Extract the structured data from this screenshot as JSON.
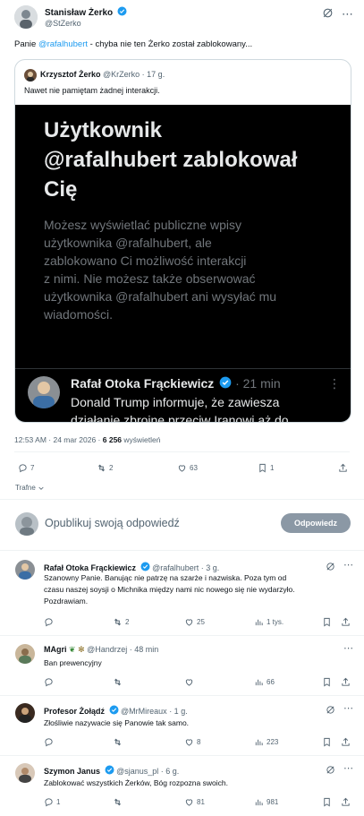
{
  "main_tweet": {
    "author_name": "Stanisław Żerko",
    "author_handle": "@StZerko",
    "text_prefix": "Panie ",
    "mention": "@rafalhubert",
    "text_suffix": " - chyba nie ten Żerko został zablokowany...",
    "timestamp": "12:53 AM · 24 mar 2026 · ",
    "views_count": "6 256",
    "views_label": " wyświetleń"
  },
  "quote": {
    "author_name": "Krzysztof Żerko",
    "author_handle": "@KrZerko · 17 g.",
    "text": "Nawet nie pamiętam żadnej interakcji.",
    "image": {
      "title_line1": "Użytkownik",
      "title_line2": "@rafalhubert zablokował",
      "title_line3": "Cię",
      "body_line1": "Możesz wyświetlać publiczne wpisy",
      "body_line2": "użytkownika @rafalhubert, ale",
      "body_line3": "zablokowano Ci możliwość interakcji",
      "body_line4": "z nimi. Nie możesz także obserwować",
      "body_line5": "użytkownika @rafalhubert ani wysyłać mu",
      "body_line6": "wiadomości.",
      "inner_author": "Rafał Otoka Frąckiewicz",
      "inner_time": "· 21 min",
      "inner_text_line1": "Donald Trump informuje, że zawiesza",
      "inner_text_line2": "działanie zbrojne przeciw Iranowi aż do"
    }
  },
  "actions": {
    "replies": "7",
    "retweets": "2",
    "likes": "63",
    "bookmarks": "1"
  },
  "sort_label": "Trafne",
  "reply_box": {
    "placeholder": "Opublikuj swoją odpowiedź",
    "button_label": "Odpowiedz"
  },
  "replies": [
    {
      "name": "Rafał Otoka Frąckiewicz",
      "handle": "@rafalhubert · 3 g.",
      "lines": [
        "Szanowny Panie. Banując nie patrzę na szarże i nazwiska. Poza tym od",
        "czasu naszej soysji o Michnika między nami nic nowego się nie wydarzyło.",
        "Pozdrawiam."
      ],
      "replies": "",
      "retweets": "2",
      "likes": "25",
      "views": "1 tys.",
      "verified": true
    },
    {
      "name": "MAgri",
      "handle": "@Handrzej · 48 min",
      "lines": [
        "Ban prewencyjny"
      ],
      "replies": "",
      "retweets": "",
      "likes": "",
      "views": "66",
      "verified": false
    },
    {
      "name": "Profesor Żołądź",
      "handle": "@MrMireaux · 1 g.",
      "lines": [
        "Złośliwie nazywacie się Panowie tak samo."
      ],
      "replies": "",
      "retweets": "",
      "likes": "8",
      "views": "223",
      "verified": true
    },
    {
      "name": "Szymon Janus",
      "handle": "@sjanus_pl · 6 g.",
      "lines": [
        "Zablokować wszystkich Żerków, Bóg rozpozna swoich."
      ],
      "replies": "1",
      "retweets": "",
      "likes": "81",
      "views": "981",
      "verified": true
    }
  ],
  "colors": {
    "accent": "#1d9bf0",
    "secondary_text": "#536471",
    "border": "#eff3f4",
    "reply_button": "#8b98a5"
  }
}
